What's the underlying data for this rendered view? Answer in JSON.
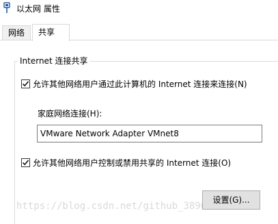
{
  "window": {
    "title": "以太网 属性",
    "icon": "network-adapter-icon"
  },
  "tabs": [
    {
      "label": "网络",
      "selected": false
    },
    {
      "label": "共享",
      "selected": true
    }
  ],
  "sharing": {
    "group_title": "Internet 连接共享",
    "allow_sharing_label": "允许其他网络用户通过此计算机的 Internet 连接来连接(N)",
    "allow_sharing_checked": true,
    "home_network_label": "家庭网络连接(H):",
    "home_network_value": "VMware Network Adapter VMnet8",
    "allow_control_label": "允许其他网络用户控制或禁用共享的 Internet 连接(O)",
    "allow_control_checked": true,
    "settings_button": "设置(G)..."
  },
  "watermark": "https://blog.csdn.net/github_38967228"
}
